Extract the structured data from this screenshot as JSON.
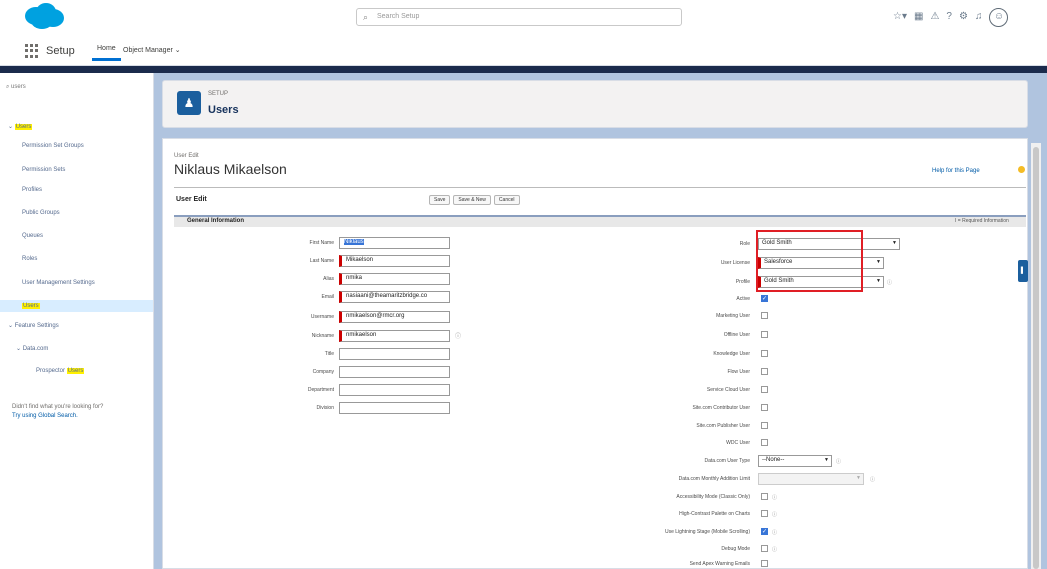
{
  "header": {
    "search_placeholder": "Search Setup",
    "icons": [
      "apps-icon",
      "favorites-icon",
      "help-icon",
      "gear-icon",
      "bell-icon",
      "avatar-icon"
    ]
  },
  "nav": {
    "app_title": "Setup",
    "tabs": [
      {
        "label": "Home"
      },
      {
        "label": "Object Manager"
      }
    ]
  },
  "sidebar": {
    "quick_find_value": "users",
    "items": [
      {
        "label": "Users"
      },
      {
        "label": "Permission Set Groups"
      },
      {
        "label": "Permission Sets"
      },
      {
        "label": "Profiles"
      },
      {
        "label": "Public Groups"
      },
      {
        "label": "Queues"
      },
      {
        "label": "Roles"
      },
      {
        "label": "User Management Settings"
      },
      {
        "label": "Users"
      },
      {
        "label": "Feature Settings"
      },
      {
        "label": "Data.com"
      },
      {
        "label_pre": "Prospector ",
        "label_hl": "Users"
      }
    ],
    "help_line1": "Didn't find what you're looking for?",
    "help_line2": "Try using Global Search."
  },
  "page": {
    "eyebrow": "SETUP",
    "title": "Users",
    "user_edit_label": "User Edit",
    "user_name": "Niklaus Mikaelson",
    "help_link": "Help for this Page",
    "bar_title": "User Edit",
    "buttons": {
      "save": "Save",
      "save_new": "Save & New",
      "cancel": "Cancel"
    },
    "section_title": "General Information",
    "required_note": "I = Required Information"
  },
  "form_left": [
    {
      "label": "First Name",
      "value": "Niklaus",
      "required": false,
      "selected": true
    },
    {
      "label": "Last Name",
      "value": "Mikaelson",
      "required": true
    },
    {
      "label": "Alias",
      "value": "nmika",
      "required": true
    },
    {
      "label": "Email",
      "value": "nasiaani@theamaritzbridge.co",
      "required": true
    },
    {
      "label": "Username",
      "value": "nmikaelson@rmcr.org",
      "required": true
    },
    {
      "label": "Nickname",
      "value": "nmikaelson",
      "required": true
    },
    {
      "label": "Title",
      "value": "",
      "required": false
    },
    {
      "label": "Company",
      "value": "",
      "required": false
    },
    {
      "label": "Department",
      "value": "",
      "required": false
    },
    {
      "label": "Division",
      "value": "",
      "required": false
    }
  ],
  "form_right": {
    "role": {
      "label": "Role",
      "value": "Gold Smith"
    },
    "user_license": {
      "label": "User License",
      "value": "Salesforce"
    },
    "profile": {
      "label": "Profile",
      "value": "Gold Smith"
    },
    "checkboxes": [
      {
        "label": "Active",
        "checked": true
      },
      {
        "label": "Marketing User",
        "checked": false
      },
      {
        "label": "Offline User",
        "checked": false
      },
      {
        "label": "Knowledge User",
        "checked": false
      },
      {
        "label": "Flow User",
        "checked": false
      },
      {
        "label": "Service Cloud User",
        "checked": false
      },
      {
        "label": "Site.com Contributor User",
        "checked": false
      },
      {
        "label": "Site.com Publisher User",
        "checked": false
      },
      {
        "label": "WDC User",
        "checked": false
      }
    ],
    "data_com_user_type": {
      "label": "Data.com User Type",
      "value": "--None--"
    },
    "accessibility_list": {
      "label": "Data.com Monthly Addition Limit",
      "value": ""
    },
    "more_checkboxes": [
      {
        "label": "Accessibility Mode (Classic Only)",
        "checked": false
      },
      {
        "label": "High-Contrast Palette on Charts",
        "checked": false
      },
      {
        "label": "Use Lightning Stage (Mobile Scrolling)",
        "checked": true
      },
      {
        "label": "Debug Mode",
        "checked": false
      },
      {
        "label": "Send Apex Warning Emails",
        "checked": false
      }
    ]
  },
  "colors": {
    "accent": "#0070d2",
    "band": "#1b2b4c",
    "highlight_box": "#e01e25",
    "required": "#cc0000"
  }
}
